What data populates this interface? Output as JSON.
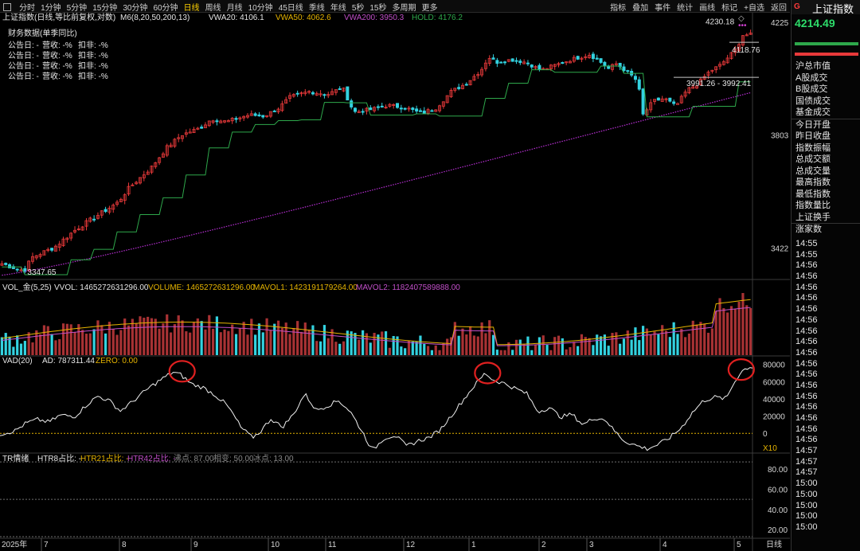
{
  "toolbar": {
    "periods": [
      "分时",
      "1分钟",
      "5分钟",
      "15分钟",
      "30分钟",
      "60分钟",
      "日线",
      "周线",
      "月线",
      "10分钟",
      "45日线",
      "季线",
      "年线",
      "5秒",
      "15秒",
      "多周期",
      "更多"
    ],
    "active_period": "日线",
    "tools": [
      "指标",
      "叠加",
      "事件",
      "统计",
      "画线",
      "标记",
      "+自选",
      "返回"
    ]
  },
  "colors": {
    "up": "#e8393a",
    "down": "#33d2e0",
    "vwa20": "#2ea84b",
    "vwa200": "#b72fd3",
    "white": "#ffffff",
    "yellow": "#e6b400",
    "pink": "#c24fc9"
  },
  "chart_data": [
    {
      "type": "candlestick",
      "title": "上证指数(日线,等比前复权,对数)",
      "indicator_label": "M6(8,20,50,200,13)",
      "legend": [
        {
          "text": "VWA20: 4106.1",
          "color": "#e6e6e6"
        },
        {
          "text": "VWA50: 4062.6",
          "color": "#e6b400"
        },
        {
          "text": "VWA200: 3950.3",
          "color": "#c24fc9"
        },
        {
          "text": "HOLD: 4176.2",
          "color": "#2ea84b"
        }
      ],
      "finance": {
        "title": "财务数据(单季同比)",
        "rows": [
          {
            "a": "公告日: -",
            "b": "营收: -%",
            "c": "扣非: -%"
          },
          {
            "a": "公告日: -",
            "b": "营收: -%",
            "c": "扣非: -%"
          },
          {
            "a": "公告日: -",
            "b": "营收: -%",
            "c": "扣非: -%"
          },
          {
            "a": "公告日: -",
            "b": "营收: -%",
            "c": "扣非: -%"
          }
        ]
      },
      "y_ticks": [
        4225,
        3803,
        3422
      ],
      "ylim": [
        3330,
        4250
      ],
      "annotations": [
        {
          "label": "3347.65",
          "y": 3347.65,
          "x_frac": 0.03
        },
        {
          "label": "4230.18",
          "y": 4230.18,
          "x_frac": 0.99
        },
        {
          "label": "4118.76",
          "y": 4118.76,
          "x_frac": 0.99
        },
        {
          "label": "3991.26 - 3992.41",
          "y": 3992.41,
          "x_frac": 0.9
        }
      ],
      "price_path": [
        {
          "x": 0.0,
          "y": 3372
        },
        {
          "x": 0.02,
          "y": 3356
        },
        {
          "x": 0.03,
          "y": 3350
        },
        {
          "x": 0.04,
          "y": 3392
        },
        {
          "x": 0.07,
          "y": 3424
        },
        {
          "x": 0.1,
          "y": 3484
        },
        {
          "x": 0.13,
          "y": 3531
        },
        {
          "x": 0.155,
          "y": 3571
        },
        {
          "x": 0.17,
          "y": 3620
        },
        {
          "x": 0.2,
          "y": 3690
        },
        {
          "x": 0.22,
          "y": 3758
        },
        {
          "x": 0.24,
          "y": 3803
        },
        {
          "x": 0.265,
          "y": 3828
        },
        {
          "x": 0.28,
          "y": 3860
        },
        {
          "x": 0.3,
          "y": 3850
        },
        {
          "x": 0.33,
          "y": 3875
        },
        {
          "x": 0.35,
          "y": 3870
        },
        {
          "x": 0.37,
          "y": 3900
        },
        {
          "x": 0.385,
          "y": 3940
        },
        {
          "x": 0.41,
          "y": 3960
        },
        {
          "x": 0.435,
          "y": 3950
        },
        {
          "x": 0.455,
          "y": 3975
        },
        {
          "x": 0.47,
          "y": 3885
        },
        {
          "x": 0.495,
          "y": 3895
        },
        {
          "x": 0.515,
          "y": 3910
        },
        {
          "x": 0.54,
          "y": 3900
        },
        {
          "x": 0.56,
          "y": 3880
        },
        {
          "x": 0.58,
          "y": 3900
        },
        {
          "x": 0.6,
          "y": 3960
        },
        {
          "x": 0.62,
          "y": 3990
        },
        {
          "x": 0.64,
          "y": 4040
        },
        {
          "x": 0.65,
          "y": 4090
        },
        {
          "x": 0.66,
          "y": 4070
        },
        {
          "x": 0.68,
          "y": 4080
        },
        {
          "x": 0.7,
          "y": 4070
        },
        {
          "x": 0.72,
          "y": 4040
        },
        {
          "x": 0.74,
          "y": 4060
        },
        {
          "x": 0.76,
          "y": 4080
        },
        {
          "x": 0.785,
          "y": 4100
        },
        {
          "x": 0.8,
          "y": 4070
        },
        {
          "x": 0.81,
          "y": 4045
        },
        {
          "x": 0.82,
          "y": 4065
        },
        {
          "x": 0.835,
          "y": 4035
        },
        {
          "x": 0.85,
          "y": 3995
        },
        {
          "x": 0.855,
          "y": 3870
        },
        {
          "x": 0.87,
          "y": 3925
        },
        {
          "x": 0.885,
          "y": 3935
        },
        {
          "x": 0.9,
          "y": 3905
        },
        {
          "x": 0.915,
          "y": 3965
        },
        {
          "x": 0.93,
          "y": 3990
        },
        {
          "x": 0.945,
          "y": 4035
        },
        {
          "x": 0.96,
          "y": 4060
        },
        {
          "x": 0.98,
          "y": 4118
        },
        {
          "x": 0.99,
          "y": 4176
        }
      ]
    },
    {
      "type": "bar",
      "title": "VOL_金(5,25)",
      "legend": [
        {
          "text": "VVOL: 1465272631296.00",
          "color": "#e6e6e6"
        },
        {
          "text": "VOLUME: 1465272631296.00",
          "color": "#e6b400"
        },
        {
          "text": "MAVOL1: 1423191179264.00",
          "color": "#e6b400"
        },
        {
          "text": "MAVOL2: 1182407589888.00",
          "color": "#c24fc9"
        }
      ]
    },
    {
      "type": "line",
      "title": "VAD(20)",
      "legend": [
        {
          "text": "AD: 787311.44",
          "color": "#e6e6e6"
        },
        {
          "text": "ZERO: 0.00",
          "color": "#e6b400"
        }
      ],
      "y_ticks": [
        80000,
        60000,
        40000,
        20000,
        0
      ],
      "ylim": [
        -22000,
        88000
      ],
      "unit": "X10",
      "series": [
        {
          "x": 0.0,
          "y": -1000
        },
        {
          "x": 0.02,
          "y": 3000
        },
        {
          "x": 0.035,
          "y": 12000
        },
        {
          "x": 0.05,
          "y": 16000
        },
        {
          "x": 0.065,
          "y": 13000
        },
        {
          "x": 0.08,
          "y": 21000
        },
        {
          "x": 0.1,
          "y": 20000
        },
        {
          "x": 0.115,
          "y": 33000
        },
        {
          "x": 0.13,
          "y": 43000
        },
        {
          "x": 0.145,
          "y": 38000
        },
        {
          "x": 0.16,
          "y": 26000
        },
        {
          "x": 0.175,
          "y": 36000
        },
        {
          "x": 0.19,
          "y": 47000
        },
        {
          "x": 0.2,
          "y": 54000
        },
        {
          "x": 0.215,
          "y": 63000
        },
        {
          "x": 0.23,
          "y": 71000
        },
        {
          "x": 0.24,
          "y": 68000
        },
        {
          "x": 0.255,
          "y": 57000
        },
        {
          "x": 0.27,
          "y": 53000
        },
        {
          "x": 0.285,
          "y": 45000
        },
        {
          "x": 0.3,
          "y": 34000
        },
        {
          "x": 0.31,
          "y": 22000
        },
        {
          "x": 0.32,
          "y": 7000
        },
        {
          "x": 0.335,
          "y": -5000
        },
        {
          "x": 0.345,
          "y": 1000
        },
        {
          "x": 0.36,
          "y": 17000
        },
        {
          "x": 0.375,
          "y": 7000
        },
        {
          "x": 0.39,
          "y": 22000
        },
        {
          "x": 0.405,
          "y": 46000
        },
        {
          "x": 0.42,
          "y": 27000
        },
        {
          "x": 0.435,
          "y": 32000
        },
        {
          "x": 0.45,
          "y": 38000
        },
        {
          "x": 0.465,
          "y": 26000
        },
        {
          "x": 0.48,
          "y": 4000
        },
        {
          "x": 0.495,
          "y": -20000
        },
        {
          "x": 0.51,
          "y": -6000
        },
        {
          "x": 0.525,
          "y": -2000
        },
        {
          "x": 0.54,
          "y": -15000
        },
        {
          "x": 0.555,
          "y": -9000
        },
        {
          "x": 0.57,
          "y": -5000
        },
        {
          "x": 0.585,
          "y": 4000
        },
        {
          "x": 0.6,
          "y": 21000
        },
        {
          "x": 0.615,
          "y": 38000
        },
        {
          "x": 0.63,
          "y": 55000
        },
        {
          "x": 0.645,
          "y": 70000
        },
        {
          "x": 0.655,
          "y": 62000
        },
        {
          "x": 0.67,
          "y": 58000
        },
        {
          "x": 0.685,
          "y": 52000
        },
        {
          "x": 0.7,
          "y": 46000
        },
        {
          "x": 0.715,
          "y": 25000
        },
        {
          "x": 0.73,
          "y": 30000
        },
        {
          "x": 0.745,
          "y": 19000
        },
        {
          "x": 0.76,
          "y": 22000
        },
        {
          "x": 0.775,
          "y": 10000
        },
        {
          "x": 0.79,
          "y": 18000
        },
        {
          "x": 0.805,
          "y": 16000
        },
        {
          "x": 0.815,
          "y": 4000
        },
        {
          "x": 0.83,
          "y": -9000
        },
        {
          "x": 0.845,
          "y": -14000
        },
        {
          "x": 0.86,
          "y": -18000
        },
        {
          "x": 0.875,
          "y": -13000
        },
        {
          "x": 0.89,
          "y": -5000
        },
        {
          "x": 0.905,
          "y": 6000
        },
        {
          "x": 0.92,
          "y": 24000
        },
        {
          "x": 0.935,
          "y": 38000
        },
        {
          "x": 0.95,
          "y": 42000
        },
        {
          "x": 0.965,
          "y": 40000
        },
        {
          "x": 0.975,
          "y": 58000
        },
        {
          "x": 0.985,
          "y": 72000
        },
        {
          "x": 0.995,
          "y": 77000
        }
      ],
      "highlights": [
        {
          "x": 0.242,
          "y": 72000
        },
        {
          "x": 0.648,
          "y": 70000
        },
        {
          "x": 0.985,
          "y": 74000
        }
      ]
    },
    {
      "type": "line",
      "title": "TR情绪",
      "legend": [
        {
          "text": "HTR8占比: -",
          "color": "#e6e6e6"
        },
        {
          "text": "HTR21占比: -",
          "color": "#e6b400"
        },
        {
          "text": "HTR42占比: -",
          "color": "#c24fc9"
        },
        {
          "text": "沸点: 87.00",
          "color": "#888888"
        },
        {
          "text": "相变: 50.00",
          "color": "#888888"
        },
        {
          "text": "冰点: 13.00",
          "color": "#888888"
        }
      ],
      "y_ticks": [
        "80.00",
        "60.00",
        "40.00",
        "20.00"
      ],
      "ylim": [
        13,
        95
      ],
      "levels": [
        87,
        50,
        13
      ]
    }
  ],
  "x_axis": {
    "year": "2025年",
    "months": [
      "7",
      "8",
      "9",
      "10",
      "11",
      "12",
      "1",
      "2",
      "3",
      "4",
      "5"
    ],
    "label": "日线"
  },
  "sidebar": {
    "badge": "G",
    "name": "上证指数",
    "price": "4214.49",
    "items": [
      "沪总市值",
      "A股成交",
      "B股成交",
      "国债成交",
      "基金成交",
      "今日开盘",
      "昨日收盘",
      "指数振幅",
      "总成交额",
      "总成交量",
      "最高指数",
      "最低指数",
      "指数量比",
      "上证换手",
      "涨家数"
    ],
    "times": [
      "14:55",
      "14:55",
      "14:56",
      "14:56",
      "14:56",
      "14:56",
      "14:56",
      "14:56",
      "14:56",
      "14:56",
      "14:56",
      "14:56",
      "14:56",
      "14:56",
      "14:56",
      "14:56",
      "14:56",
      "14:56",
      "14:56",
      "14:57",
      "14:57",
      "14:57",
      "15:00",
      "15:00",
      "15:00",
      "15:00",
      "15:00"
    ]
  }
}
